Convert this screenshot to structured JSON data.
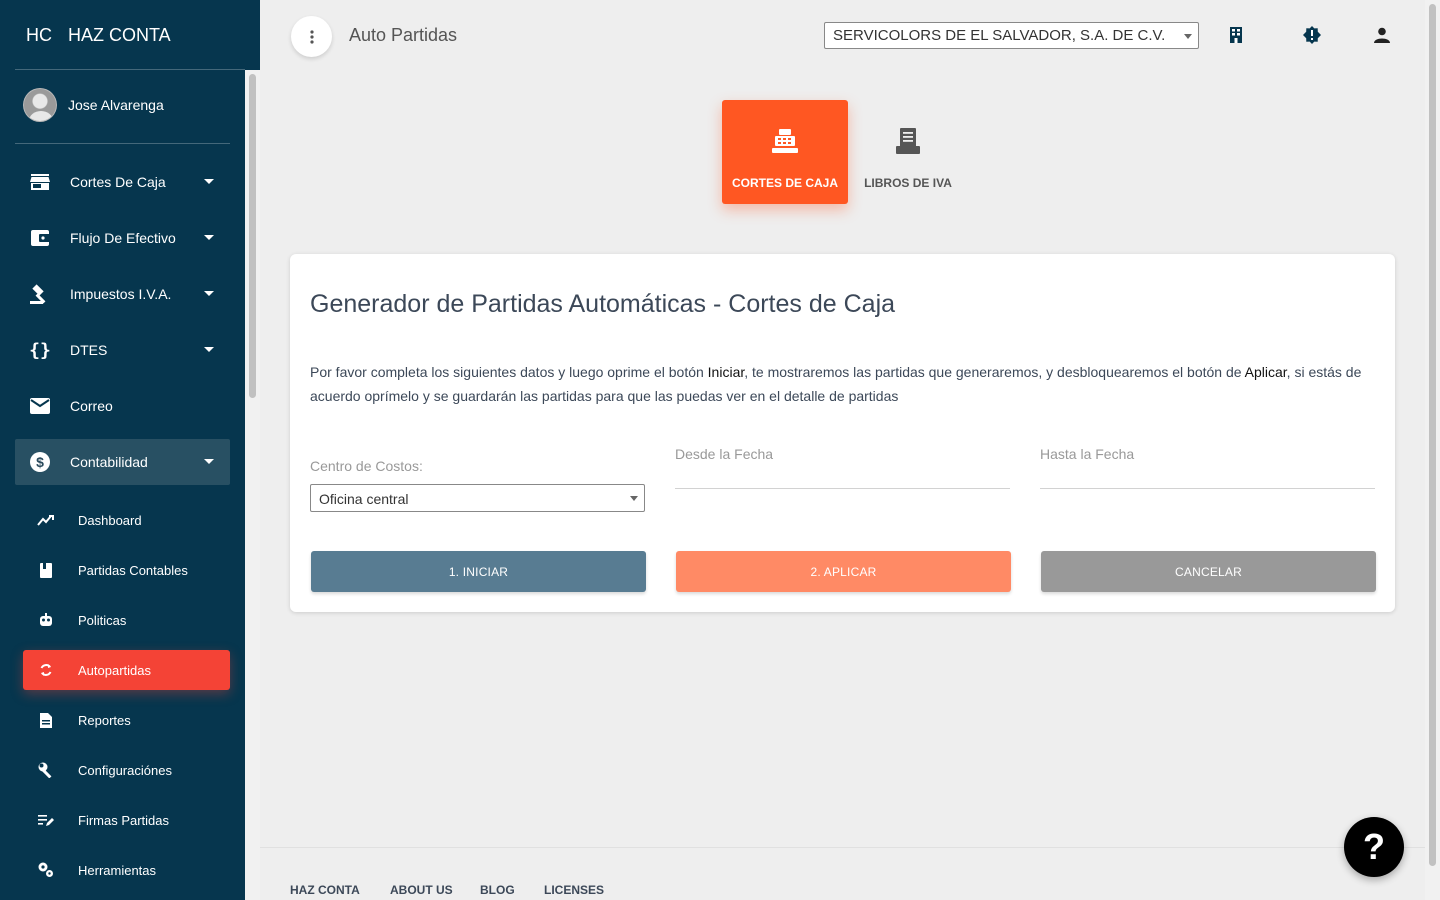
{
  "brand": {
    "mini": "HC",
    "name": "HAZ CONTA"
  },
  "user": {
    "name": "Jose Alvarenga"
  },
  "sidebar": {
    "items": [
      {
        "label": "Cortes De Caja",
        "icon": "store-icon"
      },
      {
        "label": "Flujo De Efectivo",
        "icon": "wallet-icon"
      },
      {
        "label": "Impuestos I.V.A.",
        "icon": "gavel-icon"
      },
      {
        "label": "DTES",
        "icon": "braces-icon"
      },
      {
        "label": "Correo",
        "icon": "mail-icon"
      },
      {
        "label": "Contabilidad",
        "icon": "dollar-circle-icon"
      }
    ],
    "subitems": [
      {
        "label": "Dashboard",
        "icon": "trending-icon"
      },
      {
        "label": "Partidas Contables",
        "icon": "book-icon"
      },
      {
        "label": "Politicas",
        "icon": "robot-icon"
      },
      {
        "label": "Autopartidas",
        "icon": "sync-icon"
      },
      {
        "label": "Reportes",
        "icon": "document-icon"
      },
      {
        "label": "Configuraciónes",
        "icon": "wrench-icon"
      },
      {
        "label": "Firmas Partidas",
        "icon": "edit-list-icon"
      },
      {
        "label": "Herramientas",
        "icon": "gears-icon"
      }
    ]
  },
  "topbar": {
    "title": "Auto Partidas",
    "company": "SERVICOLORS DE EL SALVADOR, S.A. DE C.V."
  },
  "tabs": [
    {
      "label": "CORTES DE CAJA",
      "icon": "cash-register-icon"
    },
    {
      "label": "LIBROS DE IVA",
      "icon": "receipt-icon"
    }
  ],
  "card": {
    "title": "Generador de Partidas Automáticas - Cortes de Caja",
    "desc_1": "Por favor completa los siguientes datos y luego oprime el botón ",
    "desc_b1": "Iniciar",
    "desc_2": ", te mostraremos las partidas que generaremos, y desbloquearemos el botón de ",
    "desc_b2": "Aplicar",
    "desc_3": ", si estás de acuerdo oprímelo y se guardarán las partidas para que las puedas ver en el detalle de partidas",
    "cost_center_label": "Centro de Costos:",
    "cost_center_value": "Oficina central",
    "from_label": "Desde la Fecha",
    "to_label": "Hasta la Fecha",
    "start_button": "1. INICIAR",
    "apply_button": "2. APLICAR",
    "cancel_button": "CANCELAR"
  },
  "footer": {
    "links": [
      "HAZ CONTA",
      "ABOUT US",
      "BLOG",
      "LICENSES"
    ]
  },
  "help": {
    "label": "?"
  },
  "colors": {
    "sidebar": "#06364e",
    "active": "#f44336",
    "tab_active": "#ff5722",
    "start": "#587c92",
    "apply": "#ff8a65",
    "cancel": "#999999"
  }
}
